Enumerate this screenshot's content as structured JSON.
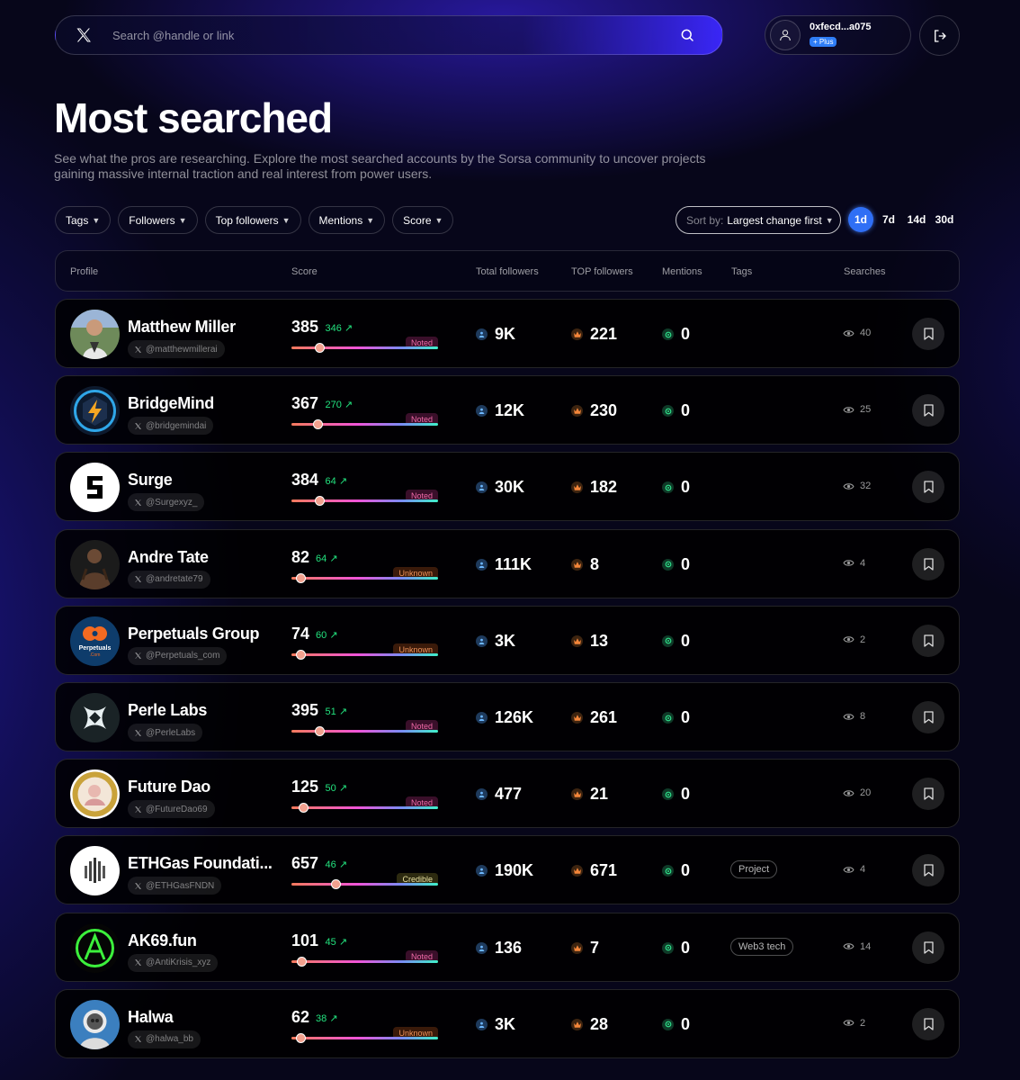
{
  "search": {
    "placeholder": "Search @handle or link"
  },
  "account": {
    "name": "0xfecd...a075",
    "plan": "+ Plus"
  },
  "title": "Most searched",
  "description": "See what the pros are researching. Explore the most searched accounts by the Sorsa community to uncover projects gaining massive internal traction and real interest from power users.",
  "filters": [
    "Tags",
    "Followers",
    "Top followers",
    "Mentions",
    "Score"
  ],
  "sort": {
    "label": "Sort by:",
    "value": "Largest change first"
  },
  "periods": [
    "1d",
    "7d",
    "14d",
    "30d"
  ],
  "active_period": "1d",
  "table": {
    "headers": [
      "Profile",
      "Score",
      "Total followers",
      "TOP followers",
      "Mentions",
      "Tags",
      "Searches"
    ],
    "rows": [
      {
        "name": "Matthew Miller",
        "handle": "@matthewmillerai",
        "score": "385",
        "delta": "346",
        "badge": "Noted",
        "score_pct": 0.19,
        "followers": "9K",
        "top_followers": "221",
        "mentions": "0",
        "tag": "",
        "searches": "40",
        "avatar": "photo-person"
      },
      {
        "name": "BridgeMind",
        "handle": "@bridgemindai",
        "score": "367",
        "delta": "270",
        "badge": "Noted",
        "score_pct": 0.18,
        "followers": "12K",
        "top_followers": "230",
        "mentions": "0",
        "tag": "",
        "searches": "25",
        "avatar": "bolt-logo"
      },
      {
        "name": "Surge",
        "handle": "@Surgexyz_",
        "score": "384",
        "delta": "64",
        "badge": "Noted",
        "score_pct": 0.19,
        "followers": "30K",
        "top_followers": "182",
        "mentions": "0",
        "tag": "",
        "searches": "32",
        "avatar": "s-logo"
      },
      {
        "name": "Andre Tate",
        "handle": "@andretate79",
        "score": "82",
        "delta": "64",
        "badge": "Unknown",
        "score_pct": 0.06,
        "followers": "111K",
        "top_followers": "8",
        "mentions": "0",
        "tag": "",
        "searches": "4",
        "avatar": "photo-person-dark"
      },
      {
        "name": "Perpetuals Group",
        "handle": "@Perpetuals_com",
        "score": "74",
        "delta": "60",
        "badge": "Unknown",
        "score_pct": 0.06,
        "followers": "3K",
        "top_followers": "13",
        "mentions": "0",
        "tag": "",
        "searches": "2",
        "avatar": "perpetuals-logo",
        "avatar_text": "Perpetuals",
        "avatar_sub": ".Com"
      },
      {
        "name": "Perle Labs",
        "handle": "@PerleLabs",
        "score": "395",
        "delta": "51",
        "badge": "Noted",
        "score_pct": 0.19,
        "followers": "126K",
        "top_followers": "261",
        "mentions": "0",
        "tag": "",
        "searches": "8",
        "avatar": "star-logo"
      },
      {
        "name": "Future Dao",
        "handle": "@FutureDao69",
        "score": "125",
        "delta": "50",
        "badge": "Noted",
        "score_pct": 0.08,
        "followers": "477",
        "top_followers": "21",
        "mentions": "0",
        "tag": "",
        "searches": "20",
        "avatar": "coin-logo"
      },
      {
        "name": "ETHGas Foundati...",
        "handle": "@ETHGasFNDN",
        "score": "657",
        "delta": "46",
        "badge": "Credible",
        "score_pct": 0.3,
        "followers": "190K",
        "top_followers": "671",
        "mentions": "0",
        "tag": "Project",
        "searches": "4",
        "avatar": "bars-logo"
      },
      {
        "name": "AK69.fun",
        "handle": "@AntiKrisis_xyz",
        "score": "101",
        "delta": "45",
        "badge": "Noted",
        "score_pct": 0.07,
        "followers": "136",
        "top_followers": "7",
        "mentions": "0",
        "tag": "Web3 tech",
        "searches": "14",
        "avatar": "a-logo"
      },
      {
        "name": "Halwa",
        "handle": "@halwa_bb",
        "score": "62",
        "delta": "38",
        "badge": "Unknown",
        "score_pct": 0.06,
        "followers": "3K",
        "top_followers": "28",
        "mentions": "0",
        "tag": "",
        "searches": "2",
        "avatar": "astronaut"
      }
    ]
  },
  "colors": {
    "accent": "#2f6ff5",
    "delta": "#23e27f",
    "noted_bg": "#3a0f2a",
    "noted_fg": "#f06aa8",
    "unknown_bg": "#3a1a0a",
    "unknown_fg": "#f0935a",
    "credible_bg": "#2d2a10",
    "credible_fg": "#e8e0a0"
  }
}
